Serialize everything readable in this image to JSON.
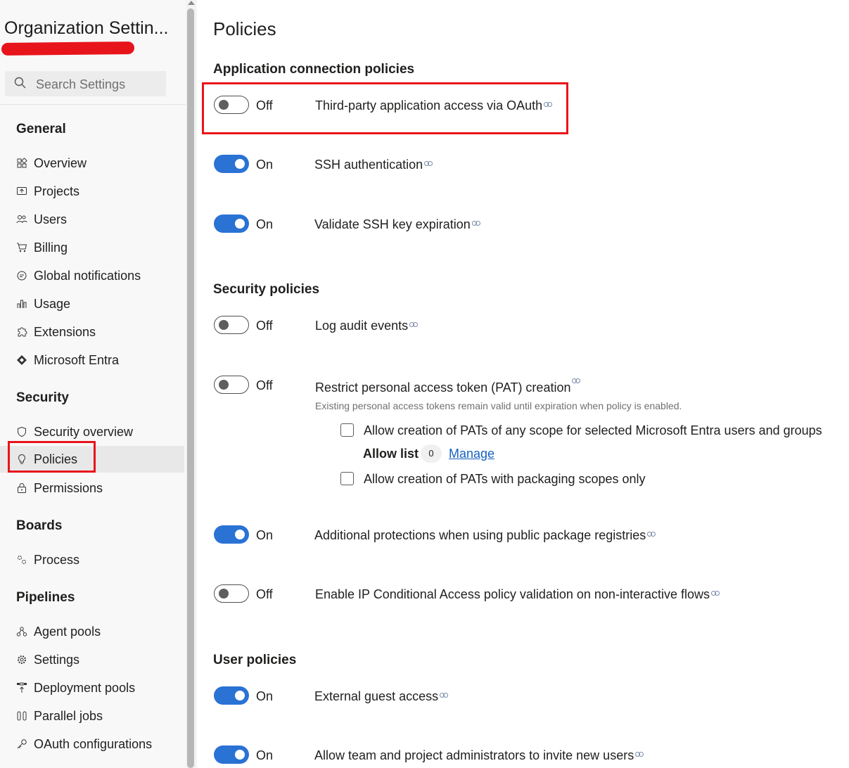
{
  "sidebar": {
    "org_title": "Organization Settin...",
    "search_placeholder": "Search Settings",
    "sections": {
      "general": "General",
      "security": "Security",
      "boards": "Boards",
      "pipelines": "Pipelines"
    },
    "items": {
      "overview": "Overview",
      "projects": "Projects",
      "users": "Users",
      "billing": "Billing",
      "global_notifications": "Global notifications",
      "usage": "Usage",
      "extensions": "Extensions",
      "microsoft_entra": "Microsoft Entra",
      "security_overview": "Security overview",
      "policies": "Policies",
      "permissions": "Permissions",
      "process": "Process",
      "agent_pools": "Agent pools",
      "settings": "Settings",
      "deployment_pools": "Deployment pools",
      "parallel_jobs": "Parallel jobs",
      "oauth_configurations": "OAuth configurations"
    },
    "selected_item": "Policies"
  },
  "main": {
    "title": "Policies",
    "groups": {
      "app_connection": "Application connection policies",
      "security": "Security policies",
      "user": "User policies"
    },
    "policies": {
      "third_party_oauth": {
        "state": "Off",
        "label": "Third-party application access via OAuth"
      },
      "ssh_auth": {
        "state": "On",
        "label": "SSH authentication"
      },
      "ssh_key_expiration": {
        "state": "On",
        "label": "Validate SSH key expiration"
      },
      "log_audit": {
        "state": "Off",
        "label": "Log audit events"
      },
      "restrict_pat": {
        "state": "Off",
        "label": "Restrict personal access token (PAT) creation",
        "description": "Existing personal access tokens remain valid until expiration when policy is enabled.",
        "option_any_scope": "Allow creation of PATs of any scope for selected Microsoft Entra users and groups",
        "allow_list_label": "Allow list",
        "allow_list_count": "0",
        "manage_link": "Manage",
        "option_packaging": "Allow creation of PATs with packaging scopes only"
      },
      "public_package": {
        "state": "On",
        "label": "Additional protections when using public package registries"
      },
      "ip_conditional": {
        "state": "Off",
        "label": "Enable IP Conditional Access policy validation on non-interactive flows"
      },
      "external_guest": {
        "state": "On",
        "label": "External guest access"
      },
      "team_admin_invite": {
        "state": "On",
        "label": "Allow team and project administrators to invite new users"
      }
    }
  },
  "colors": {
    "toggle_on": "#2a72d4",
    "highlight_box": "#e8141b",
    "link": "#1660c0"
  }
}
